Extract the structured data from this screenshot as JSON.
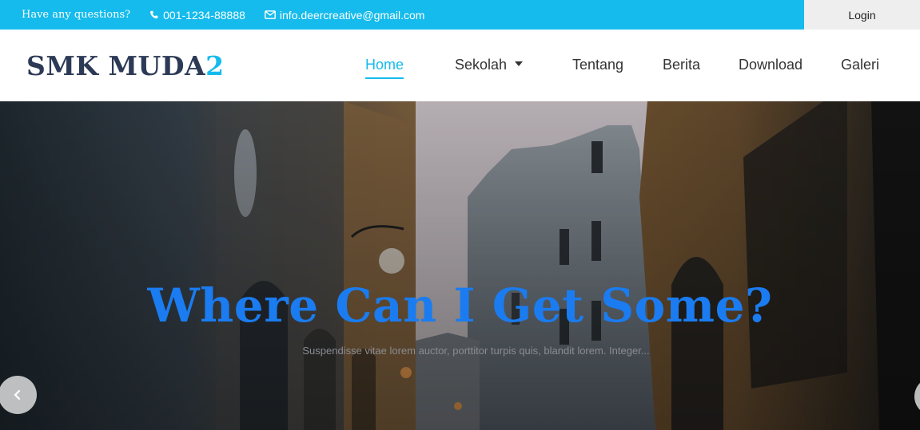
{
  "topbar": {
    "question": "Have any questions?",
    "phone": "001-1234-88888",
    "email": "info.deercreative@gmail.com",
    "login": "Login",
    "phone_icon": "phone-icon",
    "email_icon": "envelope-icon"
  },
  "brand": {
    "name": "SMK MUDA",
    "accent": "2"
  },
  "nav": {
    "items": [
      {
        "label": "Home",
        "active": true
      },
      {
        "label": "Sekolah",
        "dropdown": true
      },
      {
        "label": "Tentang"
      },
      {
        "label": "Berita"
      },
      {
        "label": "Download"
      },
      {
        "label": "Galeri"
      }
    ]
  },
  "hero": {
    "title": "Where Can I Get Some?",
    "subtitle": "Suspendisse vitae lorem auctor, porttitor turpis quis, blandit lorem. Integer...",
    "prev_icon": "chevron-left-icon",
    "next_icon": "chevron-right-icon"
  },
  "colors": {
    "accent": "#14bbec",
    "brand_text": "#2d3a56",
    "hero_title": "#1a7cf0"
  }
}
